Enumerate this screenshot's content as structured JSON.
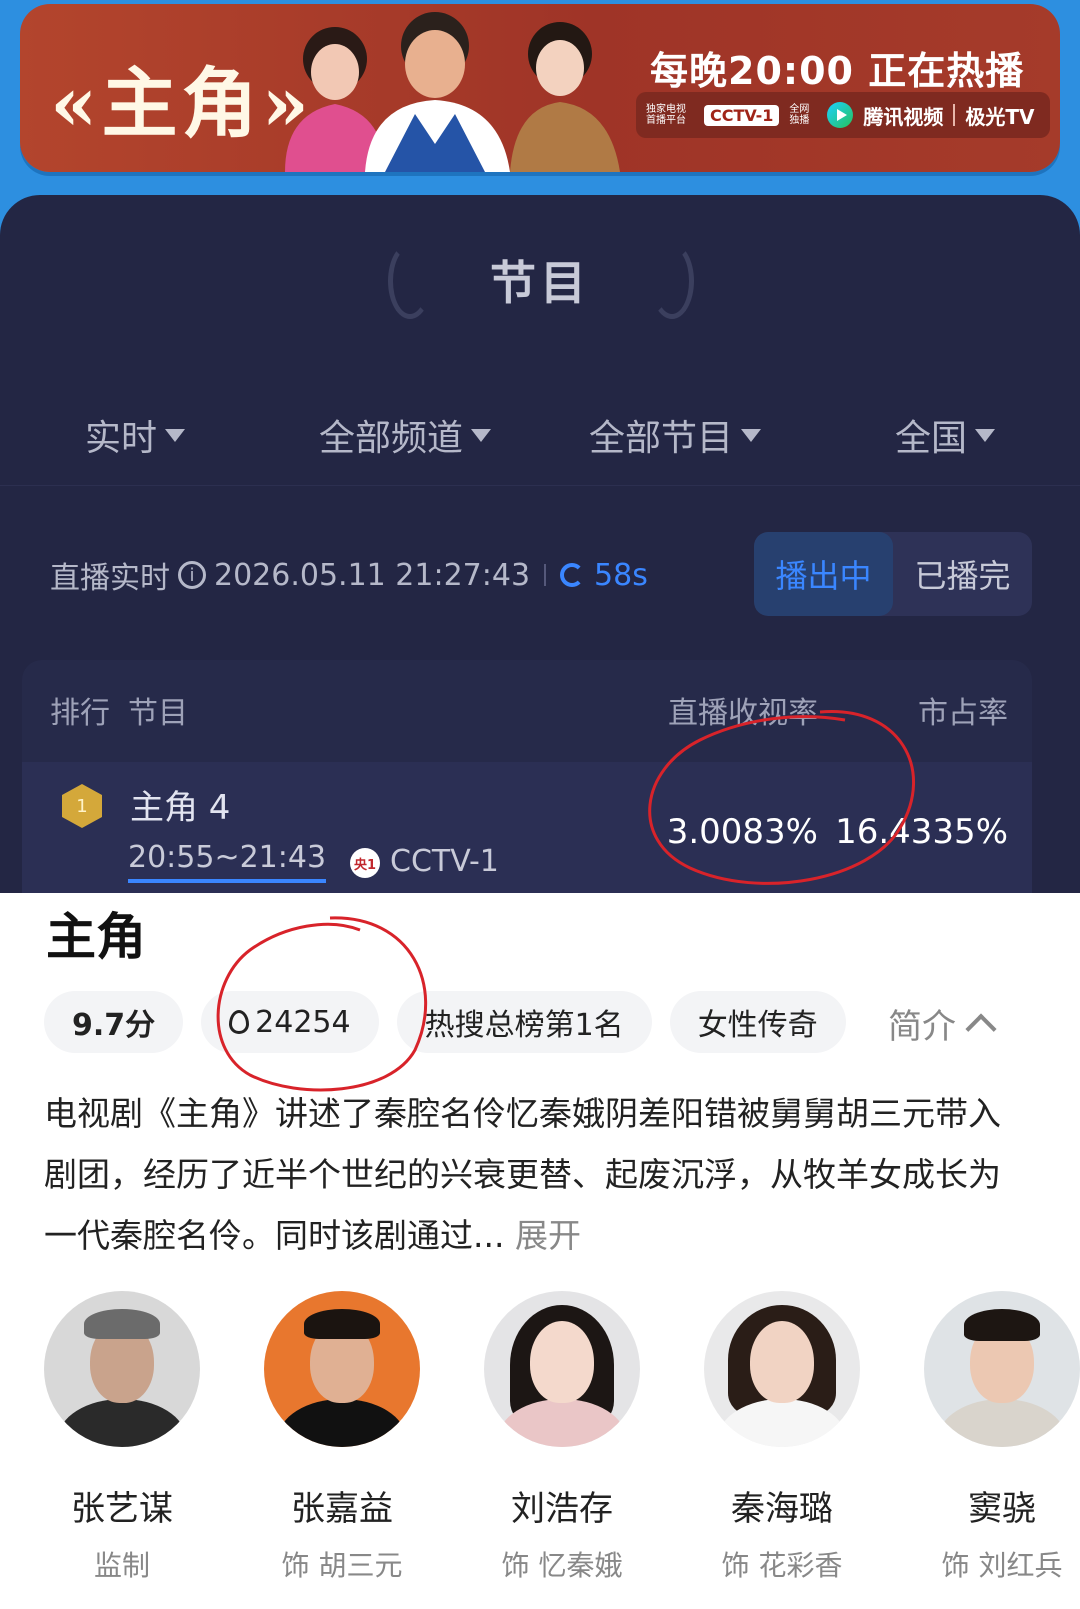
{
  "banner": {
    "logo_text": "«主角»",
    "slogan": "每晚20:00 正在热播",
    "platform_note": "独家电视首播平台",
    "channel": "CCTV-1",
    "network_note": "全网独播",
    "app_name": "腾讯视频",
    "app_name_2": "极光TV"
  },
  "panel": {
    "title": "节目",
    "filters": [
      "实时",
      "全部频道",
      "全部节目",
      "全国"
    ],
    "live_label": "直播实时",
    "timestamp": "2026.05.11 21:27:43",
    "refresh": "58s",
    "toggle": {
      "on": "播出中",
      "off": "已播完"
    },
    "table": {
      "headers": {
        "rank": "排行",
        "program": "节目",
        "rate": "直播收视率",
        "share": "市占率"
      },
      "rows": [
        {
          "rank": "1",
          "name": "主角 4",
          "time": "20:55~21:43",
          "channel_icon": "央1",
          "channel": "CCTV-1",
          "rate": "3.0083%",
          "share": "16.4335%"
        }
      ]
    }
  },
  "show": {
    "title": "主角",
    "tags": {
      "score": "9.7分",
      "heat": "24254",
      "hot_search": "热搜总榜第1名",
      "genre": "女性传奇"
    },
    "brief_label": "简介",
    "description": "电视剧《主角》讲述了秦腔名伶忆秦娥阴差阳错被舅舅胡三元带入剧团，经历了近半个世纪的兴衰更替、起废沉浮，从牧羊女成长为一代秦腔名伶。同时该剧通过...",
    "expand_label": "展开",
    "cast": [
      {
        "name": "张艺谋",
        "role": "监制"
      },
      {
        "name": "张嘉益",
        "role": "饰 胡三元"
      },
      {
        "name": "刘浩存",
        "role": "饰 忆秦娥"
      },
      {
        "name": "秦海璐",
        "role": "饰 花彩香"
      },
      {
        "name": "窦骁",
        "role": "饰 刘红兵"
      }
    ]
  },
  "colors": {
    "accent_blue": "#3a86ff",
    "panel_bg": "#232644",
    "annotation_red": "#d8232a",
    "rank_gold": "#d4a83a"
  }
}
